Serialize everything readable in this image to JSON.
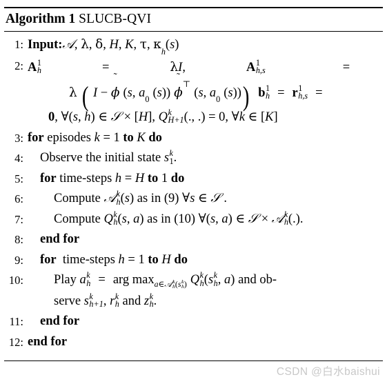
{
  "document": {
    "type": "algorithm-pseudocode",
    "title_keyword": "Algorithm 1",
    "title_name": "SLUCB-QVI"
  },
  "algorithm": {
    "lines": [
      {
        "number": "1:",
        "indent": 0,
        "text": "Input:ᴀ, λ, δ, H, K, τ, κ_h(s)",
        "keyword": "Input:"
      },
      {
        "number": "2:",
        "indent": 0,
        "text": "A^1_h = λI,  A^1_{h,s} = λ ( I − φ̃ (s, a_0 (s)) φ̃^⊤ (s, a_0 (s)) )  b^1_h = r^1_{h,s} = 0, ∀(s,h) ∈ S × [H], Q^k_{H+1}(.,.) = 0, ∀k ∈ [K]"
      },
      {
        "number": "3:",
        "indent": 0,
        "text": "for episodes k = 1 to K do"
      },
      {
        "number": "4:",
        "indent": 1,
        "text": "Observe the initial state s^k_1."
      },
      {
        "number": "5:",
        "indent": 1,
        "text": "for time-steps h = H to 1 do"
      },
      {
        "number": "6:",
        "indent": 2,
        "text": "Compute ᴀ^k_h(s) as in (9) ∀s ∈ S ."
      },
      {
        "number": "7:",
        "indent": 2,
        "text": "Compute Q^k_h(s, a) as in (10) ∀(s, a) ∈ S × ᴀ^k_h(.)."
      },
      {
        "number": "8:",
        "indent": 1,
        "text": "end for"
      },
      {
        "number": "9:",
        "indent": 1,
        "text": "for  time-steps h = 1 to H do"
      },
      {
        "number": "10:",
        "indent": 2,
        "text": "Play a^k_h = arg max_{a∈ᴀ^k_h(s^k_h)} Q^k_h(s^k_h, a) and observe s^k_{h+1}, r^k_h and z^k_h."
      },
      {
        "number": "11:",
        "indent": 1,
        "text": "end for"
      },
      {
        "number": "12:",
        "indent": 0,
        "text": "end for"
      }
    ],
    "keywords": {
      "input": "Input:",
      "for": "for",
      "to": "to",
      "do": "do",
      "end_for": "end for",
      "observe": "Observe the initial state",
      "compute": "Compute",
      "play": "Play",
      "as_in": "as in",
      "and": "and",
      "arg_max": "arg max",
      "episodes": "episodes",
      "time_steps": "time-steps",
      "and_observe_1": "and ob-",
      "and_observe_2": "serve"
    },
    "references": {
      "eq9": "(9)",
      "eq10": "(10)"
    },
    "symbols": {
      "lambda": "λ",
      "delta": "δ",
      "tau": "τ",
      "kappa": "κ",
      "phi": "ϕ",
      "tilde": "∼",
      "forall": "∀",
      "in": "∈",
      "times": "×",
      "transpose": "⊤",
      "minus": "−",
      "equals": "=",
      "cal_A": "𝒜",
      "cal_S": "𝒮"
    }
  },
  "watermark": {
    "text": "CSDN @白水baishui",
    "color": "#c8c8c8"
  },
  "colors": {
    "text": "#000000",
    "background": "#ffffff",
    "rule": "#000000"
  }
}
